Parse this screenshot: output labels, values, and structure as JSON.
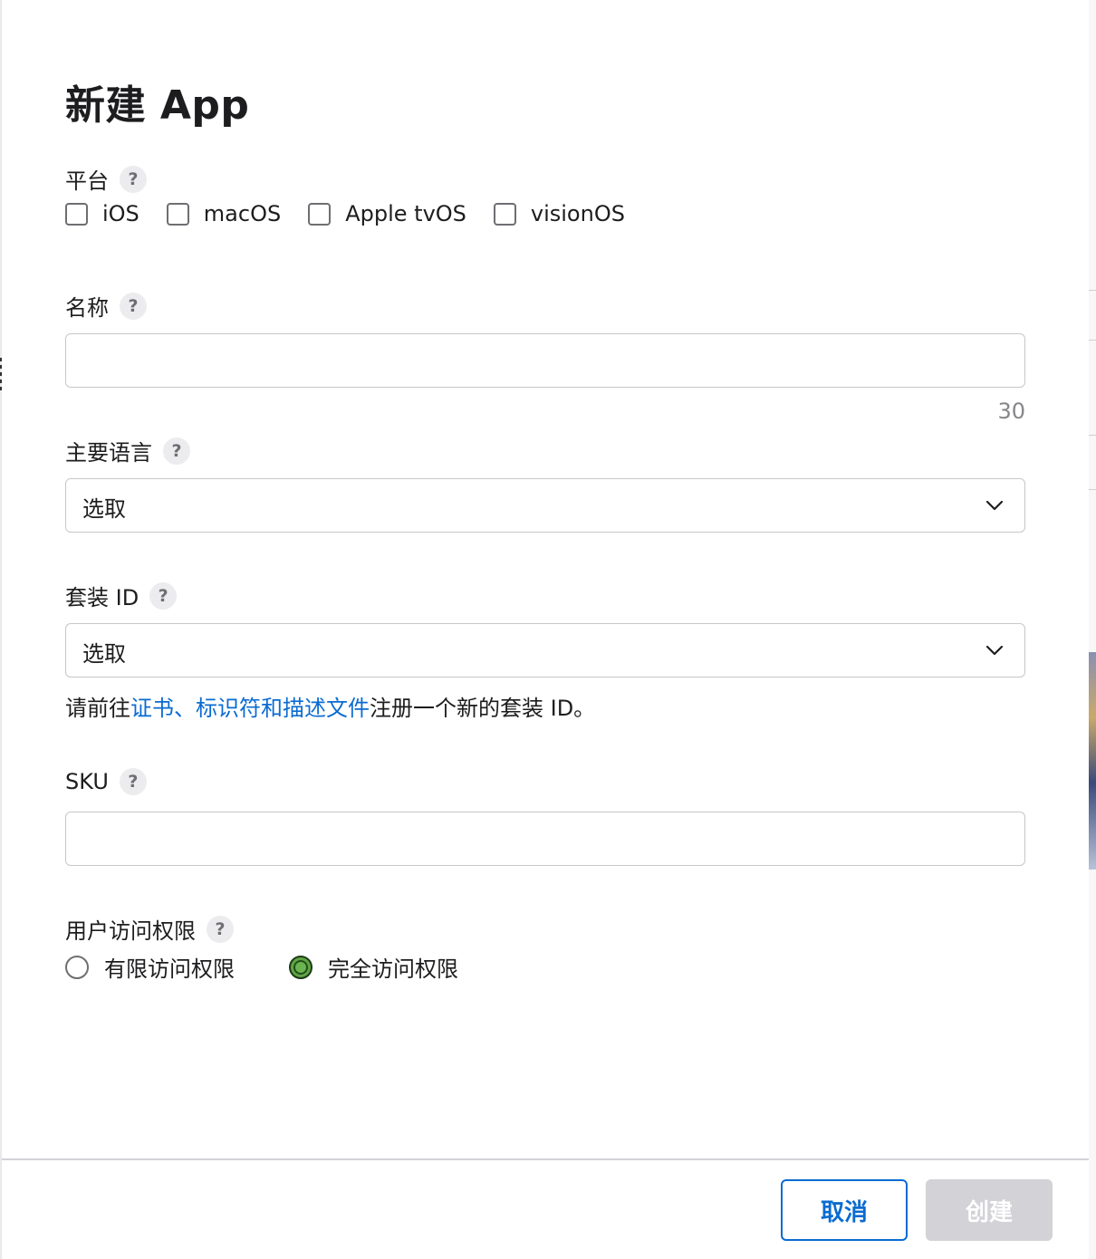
{
  "dialog": {
    "title": "新建 App",
    "platform": {
      "label": "平台",
      "options": [
        "iOS",
        "macOS",
        "Apple tvOS",
        "visionOS"
      ]
    },
    "name": {
      "label": "名称",
      "value": "",
      "counter": "30"
    },
    "primary_language": {
      "label": "主要语言",
      "selected": "选取"
    },
    "bundle_id": {
      "label": "套装 ID",
      "selected": "选取",
      "hint_prefix": "请前往",
      "hint_link": "证书、标识符和描述文件",
      "hint_suffix": "注册一个新的套装 ID。"
    },
    "sku": {
      "label": "SKU",
      "value": ""
    },
    "user_access": {
      "label": "用户访问权限",
      "options": [
        "有限访问权限",
        "完全访问权限"
      ],
      "selected": "完全访问权限"
    },
    "help_glyph": "?"
  },
  "footer": {
    "cancel_label": "取消",
    "create_label": "创建"
  },
  "colors": {
    "link": "#0a6bd1",
    "disabled_button": "#d2d2d7",
    "radio_selected": "#5fa545"
  }
}
